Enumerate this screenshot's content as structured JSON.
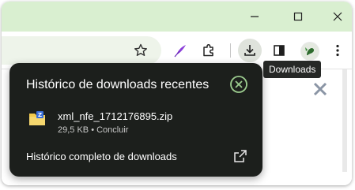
{
  "window_controls": {
    "minimize_icon": "minimize-icon",
    "maximize_icon": "maximize-icon",
    "close_icon": "close-icon"
  },
  "toolbar": {
    "bookmark_icon": "star-icon",
    "extension_quill_icon": "quill-icon",
    "extensions_icon": "puzzle-icon",
    "downloads_icon": "download-icon",
    "side_panel_icon": "side-panel-icon",
    "profile_icon": "avatar",
    "menu_icon": "more-vertical-icon"
  },
  "tooltip": {
    "text": "Downloads"
  },
  "downloads_panel": {
    "title": "Histórico de downloads recentes",
    "close_icon": "close-circle-icon",
    "items": [
      {
        "file_name": "xml_nfe_1712176895.zip",
        "status": "29,5 KB • Concluir",
        "icon": "zip-folder-icon"
      }
    ],
    "full_history_label": "Histórico completo de downloads",
    "open_external_icon": "open-external-icon"
  },
  "colors": {
    "titlebar": "#d9efd0",
    "panel_bg": "#1c1f1c",
    "accent_green": "#9ccc8f"
  }
}
